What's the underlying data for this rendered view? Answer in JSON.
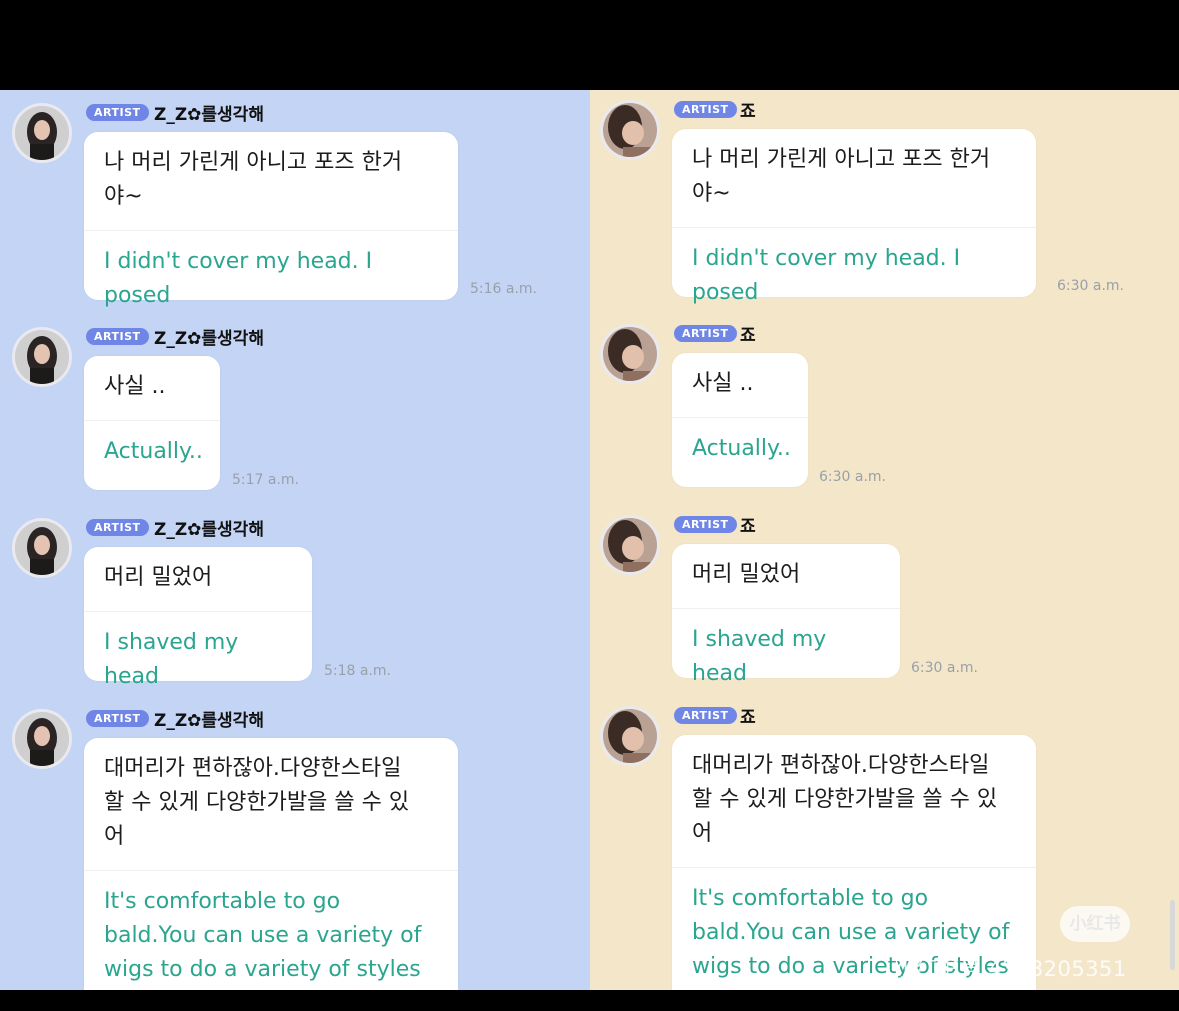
{
  "colors": {
    "left_bg": "#c3d4f5",
    "right_bg": "#f4e6c9",
    "badge": "#6f86e6",
    "translation": "#2aa58f"
  },
  "left": {
    "badge": "ARTIST",
    "name": "Z_Z✿를생각해",
    "messages": [
      {
        "ko": "나 머리 가린게 아니고 포즈 한거\n야~",
        "en": "I didn't cover my head. I posed",
        "time": "5:16 a.m."
      },
      {
        "ko": "사실 ..",
        "en": "Actually..",
        "time": "5:17 a.m."
      },
      {
        "ko": "머리 밀었어",
        "en": "I shaved my head",
        "time": "5:18 a.m."
      },
      {
        "ko": "대머리가 편하잖아.다양한스타일\n할 수 있게 다양한가발을 쓸 수 있\n어",
        "en": "It's comfortable to go\nbald.You can use a variety of\nwigs to do a variety of styles",
        "time": ""
      }
    ]
  },
  "right": {
    "badge": "ARTIST",
    "name": "죠",
    "messages": [
      {
        "ko": "나 머리 가린게 아니고 포즈 한거\n야~",
        "en": "I didn't cover my head. I posed",
        "time": "6:30 a.m."
      },
      {
        "ko": "사실 ..",
        "en": "Actually..",
        "time": "6:30 a.m."
      },
      {
        "ko": "머리 밀었어",
        "en": "I shaved my head",
        "time": "6:30 a.m."
      },
      {
        "ko": "대머리가 편하잖아.다양한스타일\n할 수 있게 다양한가발을 쓸 수 있\n어",
        "en": "It's comfortable to go\nbald.You can use a variety of\nwigs to do a variety of styles",
        "time": ""
      }
    ]
  },
  "watermark": {
    "badge": "小红书",
    "text": "小红书号 4318205351"
  }
}
